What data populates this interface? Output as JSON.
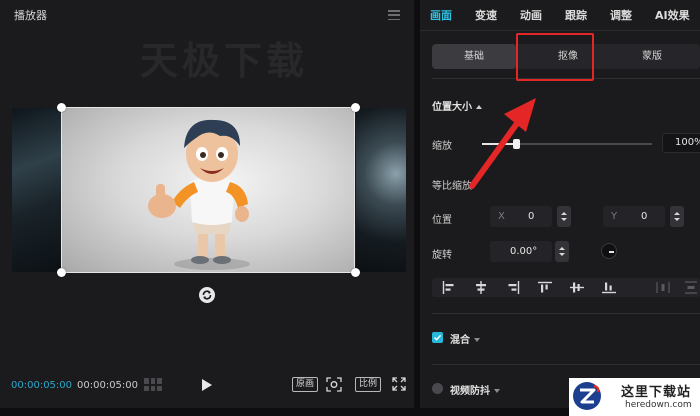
{
  "player": {
    "title": "播放器",
    "watermark": "天极下载",
    "timecode_current": "00:00:05:00",
    "timecode_total": "00:00:05:00",
    "original_label": "原画",
    "ratio_label": "比例"
  },
  "properties": {
    "tabs": [
      "画面",
      "变速",
      "动画",
      "跟踪",
      "调整",
      "AI效果"
    ],
    "active_tab": "画面",
    "subtabs": [
      "基础",
      "抠像",
      "蒙版"
    ],
    "active_subtab": "基础",
    "highlighted_subtab": "抠像",
    "section_position_size": "位置大小",
    "scale_label": "缩放",
    "scale_value": "100%",
    "scale_fraction": 0.2,
    "uniform_scale_label": "等比缩放",
    "position_label": "位置",
    "x_axis": "X",
    "x_value": "0",
    "y_axis": "Y",
    "y_value": "0",
    "rotate_label": "旋转",
    "rotate_value": "0.00°",
    "blend_label": "混合",
    "stabilize_label": "视频防抖"
  },
  "logo": {
    "title": "这里下载站",
    "subtitle": "heredown.com"
  },
  "colors": {
    "accent": "#2ec4e6",
    "highlight_red": "#e52626",
    "panel_bg": "#1b1b1d"
  }
}
